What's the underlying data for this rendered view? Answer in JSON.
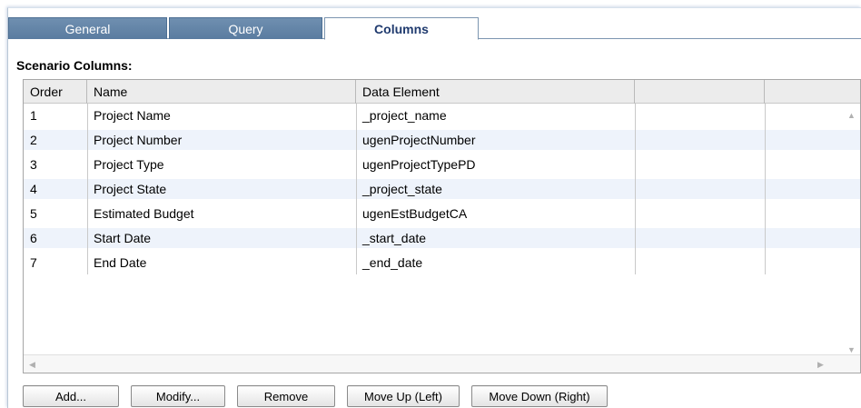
{
  "tabs": [
    {
      "label": "General",
      "active": false
    },
    {
      "label": "Query",
      "active": false
    },
    {
      "label": "Columns",
      "active": true
    }
  ],
  "section_title": "Scenario Columns:",
  "table": {
    "headers": [
      "Order",
      "Name",
      "Data Element",
      ""
    ],
    "rows": [
      {
        "order": "1",
        "name": "Project Name",
        "element": "_project_name"
      },
      {
        "order": "2",
        "name": "Project Number",
        "element": "ugenProjectNumber"
      },
      {
        "order": "3",
        "name": "Project Type",
        "element": "ugenProjectTypePD"
      },
      {
        "order": "4",
        "name": "Project State",
        "element": "_project_state"
      },
      {
        "order": "5",
        "name": "Estimated Budget",
        "element": "ugenEstBudgetCA"
      },
      {
        "order": "6",
        "name": "Start Date",
        "element": "_start_date"
      },
      {
        "order": "7",
        "name": "End Date",
        "element": "_end_date"
      }
    ]
  },
  "buttons": {
    "add": "Add...",
    "modify": "Modify...",
    "remove": "Remove",
    "move_up": "Move Up (Left)",
    "move_down": "Move Down (Right)"
  },
  "colors": {
    "tab_inactive": "#5f82a6",
    "tab_active_text": "#1f3a6e",
    "row_alt": "#eef3fb"
  },
  "icons": {
    "scroll_up": "triangle-up",
    "scroll_down": "triangle-down",
    "scroll_left": "triangle-left",
    "scroll_right": "triangle-right"
  }
}
